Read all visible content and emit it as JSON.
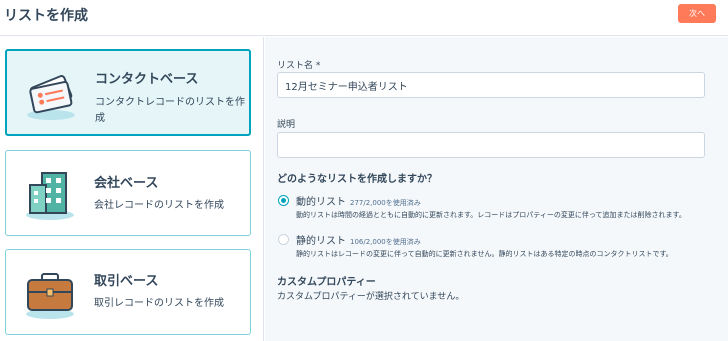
{
  "header": {
    "title": "リストを作成",
    "next_label": "次へ"
  },
  "list_types": [
    {
      "title": "コンタクトベース",
      "description": "コンタクトレコードのリストを作成",
      "icon": "contact-cards-icon",
      "selected": true
    },
    {
      "title": "会社ベース",
      "description": "会社レコードのリストを作成",
      "icon": "company-building-icon",
      "selected": false
    },
    {
      "title": "取引ベース",
      "description": "取引レコードのリストを作成",
      "icon": "deal-briefcase-icon",
      "selected": false
    }
  ],
  "form": {
    "list_name_label": "リスト名 *",
    "list_name_value": "12月セミナー申込者リスト",
    "description_label": "説明",
    "description_value": "",
    "list_kind_question": "どのようなリストを作成しますか？",
    "options": [
      {
        "label": "動的リスト",
        "usage": "277/2,000を使用済み",
        "help": "動的リストは時間の経過とともに自動的に更新されます。レコードはプロパティーの変更に伴って追加または削除されます。",
        "checked": true
      },
      {
        "label": "静的リスト",
        "usage": "106/2,000を使用済み",
        "help": "静的リストはレコードの変更に伴って自動的に更新されません。静的リストはある特定の時点のコンタクトリストです。",
        "checked": false
      }
    ],
    "custom_properties_heading": "カスタムプロパティー",
    "custom_properties_note": "カスタムプロパティーが選択されていません。"
  },
  "colors": {
    "accent": "#00a4bd",
    "button": "#ff7a59",
    "text": "#33475b"
  }
}
